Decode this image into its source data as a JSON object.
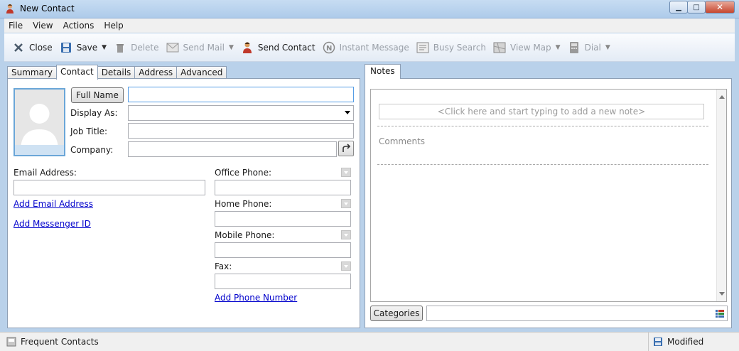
{
  "window": {
    "title": "New Contact",
    "minimize": "▁",
    "maximize": "□",
    "close": "✕"
  },
  "menu": [
    "File",
    "View",
    "Actions",
    "Help"
  ],
  "toolbar": {
    "close": "Close",
    "save": "Save",
    "delete": "Delete",
    "send_mail": "Send Mail",
    "send_contact": "Send Contact",
    "instant_message": "Instant Message",
    "busy_search": "Busy Search",
    "view_map": "View Map",
    "dial": "Dial"
  },
  "tabs": [
    "Summary",
    "Contact",
    "Details",
    "Address",
    "Advanced"
  ],
  "active_tab": "Contact",
  "notes_tab": "Notes",
  "contact": {
    "full_name_button": "Full Name",
    "display_as_label": "Display As:",
    "job_title_label": "Job Title:",
    "company_label": "Company:",
    "full_name_value": "",
    "display_as_value": "",
    "job_title_value": "",
    "company_value": "",
    "email_label": "Email Address:",
    "email_value": "",
    "add_email": "Add Email Address",
    "add_messenger": "Add Messenger ID",
    "office_phone_label": "Office Phone:",
    "home_phone_label": "Home Phone:",
    "mobile_phone_label": "Mobile Phone:",
    "fax_label": "Fax:",
    "office_phone_value": "",
    "home_phone_value": "",
    "mobile_phone_value": "",
    "fax_value": "",
    "add_phone": "Add Phone Number"
  },
  "notes": {
    "placeholder": "<Click here and start typing to add a new note>",
    "comments": "Comments",
    "categories_button": "Categories",
    "categories_value": ""
  },
  "status": {
    "left": "Frequent Contacts",
    "right": "Modified"
  }
}
